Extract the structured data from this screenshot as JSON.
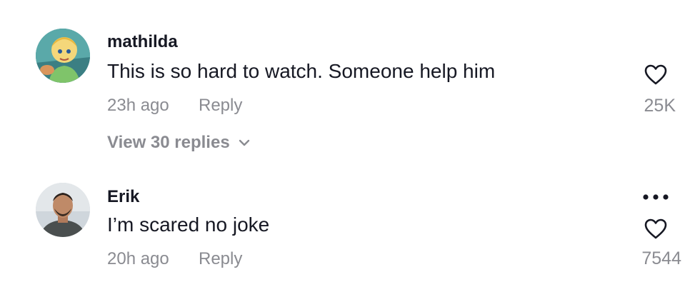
{
  "comments": [
    {
      "username": "mathilda",
      "text": "This is so hard to watch. Someone help him",
      "time": "23h ago",
      "reply_label": "Reply",
      "like_count": "25K",
      "view_replies_label": "View 30 replies"
    },
    {
      "username": "Erik",
      "text": "I’m scared no joke",
      "time": "20h ago",
      "reply_label": "Reply",
      "like_count": "7544"
    }
  ],
  "icons": {
    "like": "heart-outline-icon",
    "more": "more-horizontal-icon",
    "expand": "chevron-down-icon"
  },
  "colors": {
    "primary_text": "#161823",
    "secondary_text": "#8a8b91",
    "icon_stroke": "#161823"
  }
}
